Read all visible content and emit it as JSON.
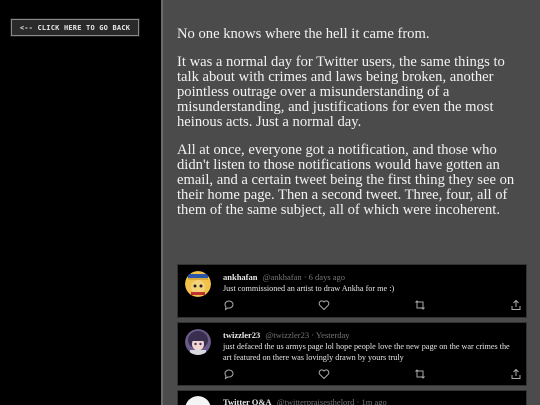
{
  "back_button": {
    "label": "<-- CLICK HERE TO GO BACK"
  },
  "story": {
    "paragraphs": [
      "No one knows where the hell it came from.",
      "It was a normal day for Twitter users, the same things to talk about with crimes and laws being broken, another pointless outrage over a misunderstanding of a misunderstanding, and justifications for even the most heinous acts. Just a normal day.",
      "All at once, everyone got a notification, and those who didn't listen to those notifications would have gotten an email, and a certain tweet being the first thing they see on their home page. Then a second tweet. Three, four, all of them of the same subject, all of which were incoherent."
    ]
  },
  "tweets": [
    {
      "name": "ankhafan",
      "handle": "@ankhafan · 6 days ago",
      "text": "Just commissioned an artist to draw Ankha for me :)",
      "avatar_icon": "ankha-cat-avatar"
    },
    {
      "name": "twizzler23",
      "handle": "@twizzler23 · Yesterday",
      "text": "just defaced the us armys page lol hope people love the new page on the war crimes the art featured on there was lovingly drawn by yours truly",
      "avatar_icon": "anime-girl-avatar"
    },
    {
      "name": "Twitter Q&A",
      "handle": "@twitterpraisesthelord · 1m ago",
      "text": "",
      "avatar_icon": "default-avatar"
    }
  ],
  "colors": {
    "panel": "#4b4b4b",
    "page": "#000000",
    "tweet_bg": "#000000",
    "handle": "#777777"
  },
  "icons": [
    "reply-icon",
    "like-icon",
    "retweet-icon",
    "share-icon"
  ]
}
